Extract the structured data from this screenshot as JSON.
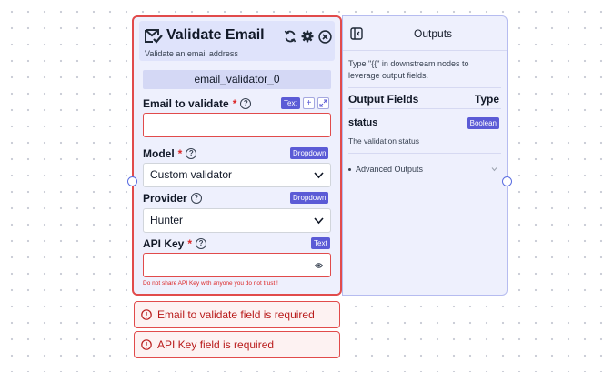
{
  "node": {
    "title": "Validate Email",
    "subtitle": "Validate an email address",
    "id_label": "email_validator_0",
    "fields": {
      "email": {
        "label": "Email to validate",
        "required": "*",
        "badge": "Text",
        "value": "",
        "add_symbol": "+"
      },
      "model": {
        "label": "Model",
        "required": "*",
        "badge": "Dropdown",
        "value": "Custom validator"
      },
      "provider": {
        "label": "Provider",
        "badge": "Dropdown",
        "value": "Hunter"
      },
      "api_key": {
        "label": "API Key",
        "required": "*",
        "badge": "Text",
        "value": "",
        "warning": "Do not share API Key with anyone you do not trust !"
      }
    }
  },
  "outputs": {
    "title": "Outputs",
    "hint": "Type \"{{\" in downstream nodes to leverage output fields.",
    "fields_header": "Output Fields",
    "type_header": "Type",
    "items": [
      {
        "name": "status",
        "type": "Boolean",
        "description": "The validation status"
      }
    ],
    "advanced_label": "Advanced Outputs"
  },
  "errors": [
    "Email to validate field is required",
    "API Key field is required"
  ],
  "colors": {
    "accent": "#5b5bd6",
    "error": "#e14b4b",
    "node_bg": "#eef0fd"
  },
  "icons": [
    "email-check-icon",
    "refresh-icon",
    "gear-icon",
    "close-circle-icon",
    "help-icon",
    "expand-icon",
    "chevron-down-icon",
    "eye-icon",
    "collapse-panel-icon",
    "error-icon"
  ]
}
